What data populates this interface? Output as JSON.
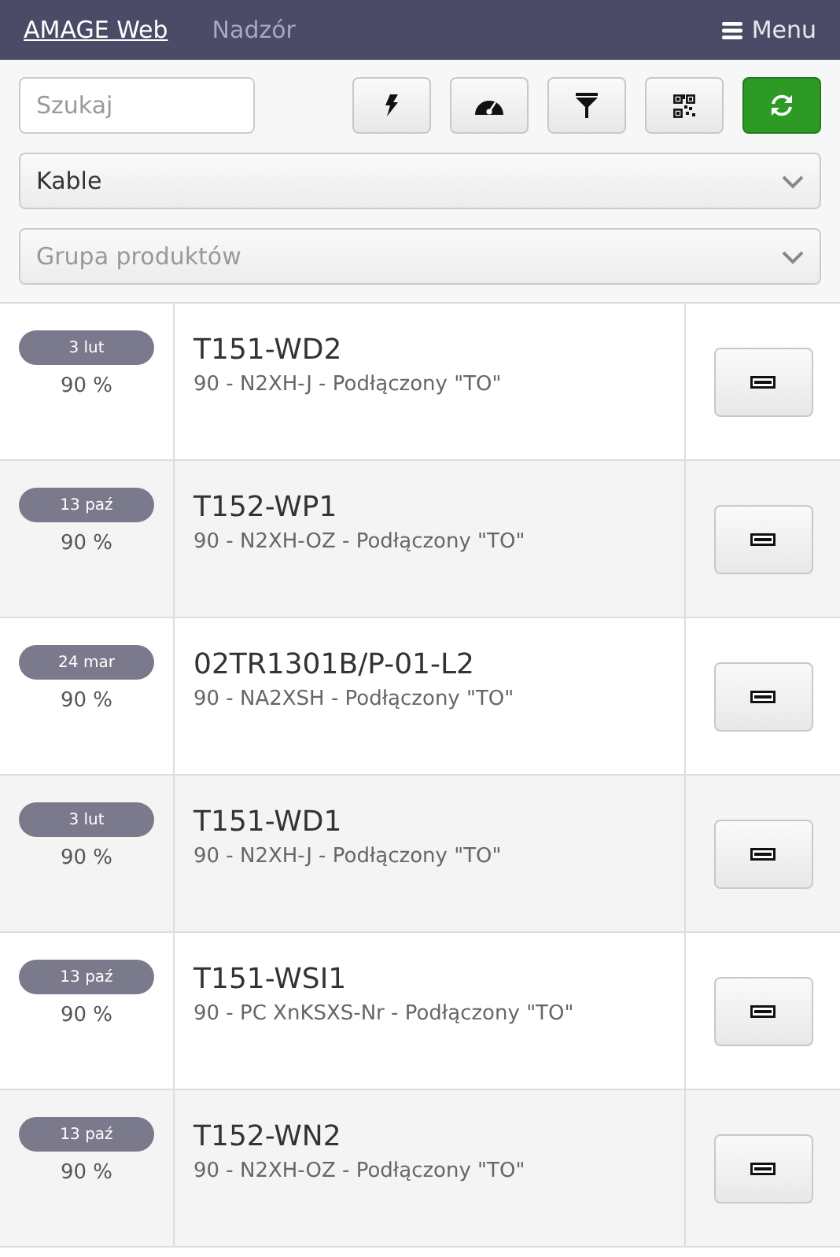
{
  "navbar": {
    "brand": "AMAGE Web",
    "link": "Nadzór",
    "menu": "Menu"
  },
  "search": {
    "placeholder": "Szukaj"
  },
  "tools": [
    {
      "kind": "bolt"
    },
    {
      "kind": "gauge"
    },
    {
      "kind": "filter"
    },
    {
      "kind": "qr"
    },
    {
      "kind": "refresh"
    }
  ],
  "selects": [
    {
      "value": "Kable"
    },
    {
      "placeholder": "Grupa produktów"
    }
  ],
  "rows": [
    {
      "date": "3 lut",
      "percent": "90 %",
      "title": "T151-WD2",
      "detail": "90 - N2XH-J - Podłączony \"TO\""
    },
    {
      "date": "13 paź",
      "percent": "90 %",
      "title": "T152-WP1",
      "detail": "90 - N2XH-OZ - Podłączony \"TO\""
    },
    {
      "date": "24 mar",
      "percent": "90 %",
      "title": "02TR1301B/P-01-L2",
      "detail": "90 - NA2XSH - Podłączony \"TO\""
    },
    {
      "date": "3 lut",
      "percent": "90 %",
      "title": "T151-WD1",
      "detail": "90 - N2XH-J - Podłączony \"TO\""
    },
    {
      "date": "13 paź",
      "percent": "90 %",
      "title": "T151-WSI1",
      "detail": "90 - PC XnKSXS-Nr - Podłączony \"TO\""
    },
    {
      "date": "13 paź",
      "percent": "90 %",
      "title": "T152-WN2",
      "detail": "90 - N2XH-OZ - Podłączony \"TO\""
    }
  ]
}
